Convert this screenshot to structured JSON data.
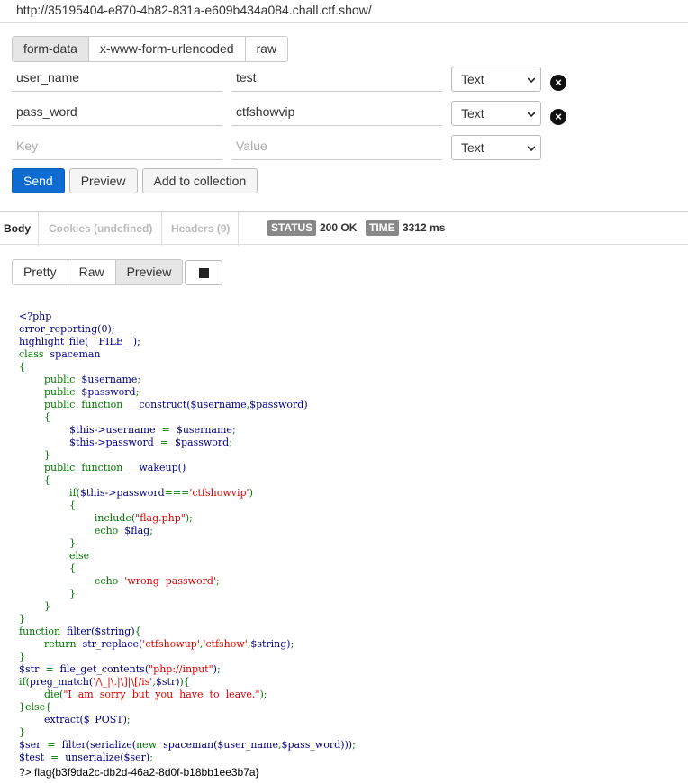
{
  "url": "http://35195404-e870-4b82-831a-e609b434a084.chall.ctf.show/",
  "body_tabs": [
    "form-data",
    "x-www-form-urlencoded",
    "raw"
  ],
  "params": [
    {
      "key": "user_name",
      "value": "test",
      "type": "Text"
    },
    {
      "key": "pass_word",
      "value": "ctfshowvip",
      "type": "Text"
    }
  ],
  "new_param": {
    "key_placeholder": "Key",
    "value_placeholder": "Value",
    "type": "Text"
  },
  "actions": {
    "send": "Send",
    "preview": "Preview",
    "add": "Add to collection"
  },
  "response_tabs": {
    "body": "Body",
    "cookies": "Cookies (undefined)",
    "headers": "Headers (9)"
  },
  "status": {
    "label": "STATUS",
    "value": "200 OK"
  },
  "time": {
    "label": "TIME",
    "value": "3312 ms"
  },
  "view_tabs": [
    "Pretty",
    "Raw",
    "Preview"
  ],
  "code_lines": [
    [
      [
        "d",
        "<?php"
      ]
    ],
    [
      [
        "d",
        "error_reporting(0);"
      ]
    ],
    [
      [
        "d",
        "highlight_file(__FILE__);"
      ]
    ],
    [
      [
        "k",
        "class"
      ],
      [
        "d",
        "  spaceman"
      ]
    ],
    [
      [
        "k",
        "{"
      ]
    ],
    [
      [
        "k",
        "        public"
      ],
      [
        "d",
        "  $username"
      ],
      [
        "k",
        ";"
      ]
    ],
    [
      [
        "k",
        "        public"
      ],
      [
        "d",
        "  $password"
      ],
      [
        "k",
        ";"
      ]
    ],
    [
      [
        "k",
        "        public"
      ],
      [
        "k",
        "  function"
      ],
      [
        "d",
        "  __construct($username"
      ],
      [
        "k",
        ","
      ],
      [
        "d",
        "$password)"
      ]
    ],
    [
      [
        "k",
        "        {"
      ]
    ],
    [
      [
        "d",
        "                $this->username"
      ],
      [
        "k",
        "  =  "
      ],
      [
        "d",
        "$username"
      ],
      [
        "k",
        ";"
      ]
    ],
    [
      [
        "d",
        "                $this->password"
      ],
      [
        "k",
        "  =  "
      ],
      [
        "d",
        "$password"
      ],
      [
        "k",
        ";"
      ]
    ],
    [
      [
        "k",
        "        }"
      ]
    ],
    [
      [
        "k",
        "        public"
      ],
      [
        "k",
        "  function"
      ],
      [
        "d",
        "  __wakeup()"
      ]
    ],
    [
      [
        "k",
        "        {"
      ]
    ],
    [
      [
        "k",
        "                if("
      ],
      [
        "d",
        "$this->password"
      ],
      [
        "k",
        "==="
      ],
      [
        "s",
        "'ctfshowvip'"
      ],
      [
        "k",
        ")"
      ]
    ],
    [
      [
        "k",
        "                {"
      ]
    ],
    [
      [
        "k",
        "                        include("
      ],
      [
        "s",
        "\"flag.php\""
      ],
      [
        "k",
        ");"
      ]
    ],
    [
      [
        "k",
        "                        echo"
      ],
      [
        "d",
        "  $flag"
      ],
      [
        "k",
        ";"
      ]
    ],
    [
      [
        "k",
        "                }"
      ]
    ],
    [
      [
        "k",
        "                else"
      ]
    ],
    [
      [
        "k",
        "                {"
      ]
    ],
    [
      [
        "k",
        "                        echo"
      ],
      [
        "s",
        "  'wrong  password'"
      ],
      [
        "k",
        ";"
      ]
    ],
    [
      [
        "k",
        "                }"
      ]
    ],
    [
      [
        "k",
        "        }"
      ]
    ],
    [
      [
        "k",
        "}"
      ]
    ],
    [
      [
        "k",
        "function"
      ],
      [
        "d",
        "  filter($string)"
      ],
      [
        "k",
        "{"
      ]
    ],
    [
      [
        "k",
        "        return"
      ],
      [
        "d",
        "  str_replace("
      ],
      [
        "s",
        "'ctfshowup'"
      ],
      [
        "k",
        ","
      ],
      [
        "s",
        "'ctfshow'"
      ],
      [
        "k",
        ","
      ],
      [
        "d",
        "$string)"
      ],
      [
        "k",
        ";"
      ]
    ],
    [
      [
        "k",
        "}"
      ]
    ],
    [
      [
        "d",
        "$str"
      ],
      [
        "k",
        "  =  "
      ],
      [
        "d",
        "file_get_contents("
      ],
      [
        "s",
        "\"php://input\""
      ],
      [
        "d",
        ")"
      ],
      [
        "k",
        ";"
      ]
    ],
    [
      [
        "k",
        "if("
      ],
      [
        "d",
        "preg_match("
      ],
      [
        "s",
        "'/\\_|\\.|\\]|\\[/is'"
      ],
      [
        "k",
        ","
      ],
      [
        "d",
        "$str)"
      ],
      [
        "k",
        "){"
      ]
    ],
    [
      [
        "k",
        "        die("
      ],
      [
        "s",
        "\"I  am  sorry  but  you  have  to  leave.\""
      ],
      [
        "k",
        ");"
      ]
    ],
    [
      [
        "k",
        "}else{"
      ]
    ],
    [
      [
        "d",
        "        extract($_POST)"
      ],
      [
        "k",
        ";"
      ]
    ],
    [
      [
        "k",
        "}"
      ]
    ],
    [
      [
        "d",
        "$ser"
      ],
      [
        "k",
        "  =  "
      ],
      [
        "d",
        "filter(serialize("
      ],
      [
        "k",
        "new"
      ],
      [
        "d",
        "  spaceman($user_name"
      ],
      [
        "k",
        ","
      ],
      [
        "d",
        "$pass_word)))"
      ],
      [
        "k",
        ";"
      ]
    ],
    [
      [
        "d",
        "$test"
      ],
      [
        "k",
        "  =  "
      ],
      [
        "d",
        "unserialize($ser)"
      ],
      [
        "k",
        ";"
      ]
    ]
  ],
  "flag_prefix": "?>",
  "flag": "flag{b3f9da2c-db2d-46a2-8d0f-b18bb1ee3b7a}",
  "colors": {
    "keyword": "#007700",
    "string": "#dd0000",
    "default": "#000080",
    "send": "#0d6bd1"
  }
}
